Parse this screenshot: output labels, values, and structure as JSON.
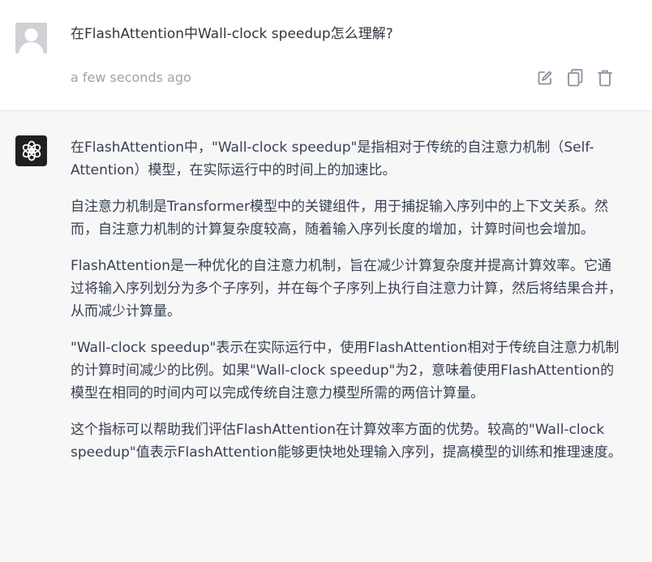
{
  "user_message": {
    "text": "在FlashAttention中Wall-clock speedup怎么理解?",
    "timestamp": "a few seconds ago"
  },
  "actions": {
    "edit_icon": "edit-icon",
    "copy_icon": "copy-icon",
    "delete_icon": "trash-icon"
  },
  "assistant_message": {
    "paragraphs": [
      "在FlashAttention中，\"Wall-clock speedup\"是指相对于传统的自注意力机制（Self-Attention）模型，在实际运行中的时间上的加速比。",
      "自注意力机制是Transformer模型中的关键组件，用于捕捉输入序列中的上下文关系。然而，自注意力机制的计算复杂度较高，随着输入序列长度的增加，计算时间也会增加。",
      "FlashAttention是一种优化的自注意力机制，旨在减少计算复杂度并提高计算效率。它通过将输入序列划分为多个子序列，并在每个子序列上执行自注意力计算，然后将结果合并，从而减少计算量。",
      "\"Wall-clock speedup\"表示在实际运行中，使用FlashAttention相对于传统自注意力机制的计算时间减少的比例。如果\"Wall-clock speedup\"为2，意味着使用FlashAttention的模型在相同的时间内可以完成传统自注意力模型所需的两倍计算量。",
      "这个指标可以帮助我们评估FlashAttention在计算效率方面的优势。较高的\"Wall-clock speedup\"值表示FlashAttention能够更快地处理输入序列，提高模型的训练和推理速度。"
    ]
  },
  "colors": {
    "assistant_bg": "#f7f7f8",
    "bot_avatar_bg": "#1f1f1f",
    "user_avatar_bg": "#cfd1d4",
    "timestamp": "#9ca3af"
  }
}
